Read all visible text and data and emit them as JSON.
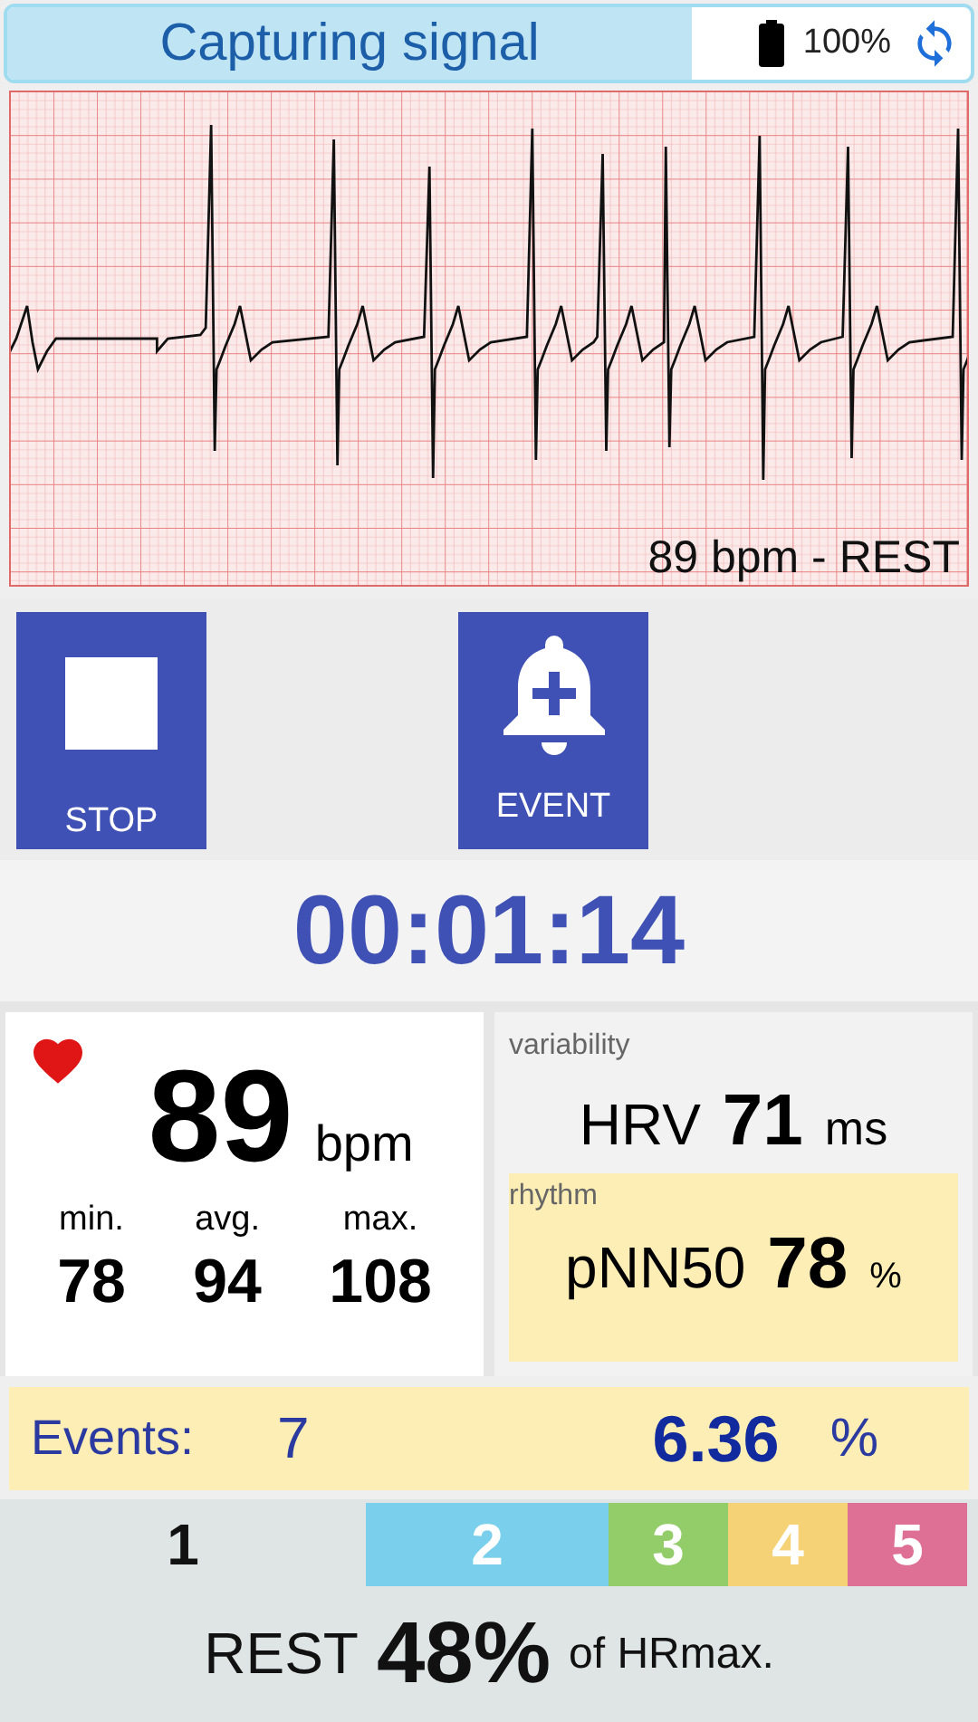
{
  "header": {
    "title": "Capturing signal",
    "battery": "100%"
  },
  "ecg": {
    "reading": "89 bpm - REST"
  },
  "buttons": [
    {
      "kind": "stop",
      "label": "STOP"
    },
    {
      "kind": "event",
      "label": "EVENT"
    }
  ],
  "timer": "00:01:14",
  "heart_rate": {
    "value": "89",
    "unit": "bpm",
    "stats": [
      {
        "label": "min.",
        "value": "78"
      },
      {
        "label": "avg.",
        "value": "94"
      },
      {
        "label": "max.",
        "value": "108"
      }
    ]
  },
  "variability": {
    "heading": "variability",
    "label": "HRV",
    "value": "71",
    "unit": "ms"
  },
  "rhythm": {
    "heading": "rhythm",
    "label": "pNN50",
    "value": "78",
    "unit": "%"
  },
  "events": {
    "label": "Events:",
    "count": "7",
    "percent": "6.36",
    "unit": "%"
  },
  "zones": [
    {
      "label": "1",
      "selected": true
    },
    {
      "label": "2",
      "selected": false,
      "color": "#7ad0ec"
    },
    {
      "label": "3",
      "selected": false,
      "color": "#93cd6a"
    },
    {
      "label": "4",
      "selected": false,
      "color": "#f5d276"
    },
    {
      "label": "5",
      "selected": false,
      "color": "#de7096"
    }
  ],
  "zone_summary": {
    "name": "REST",
    "percent": "48%",
    "suffix": "of HRmax."
  }
}
